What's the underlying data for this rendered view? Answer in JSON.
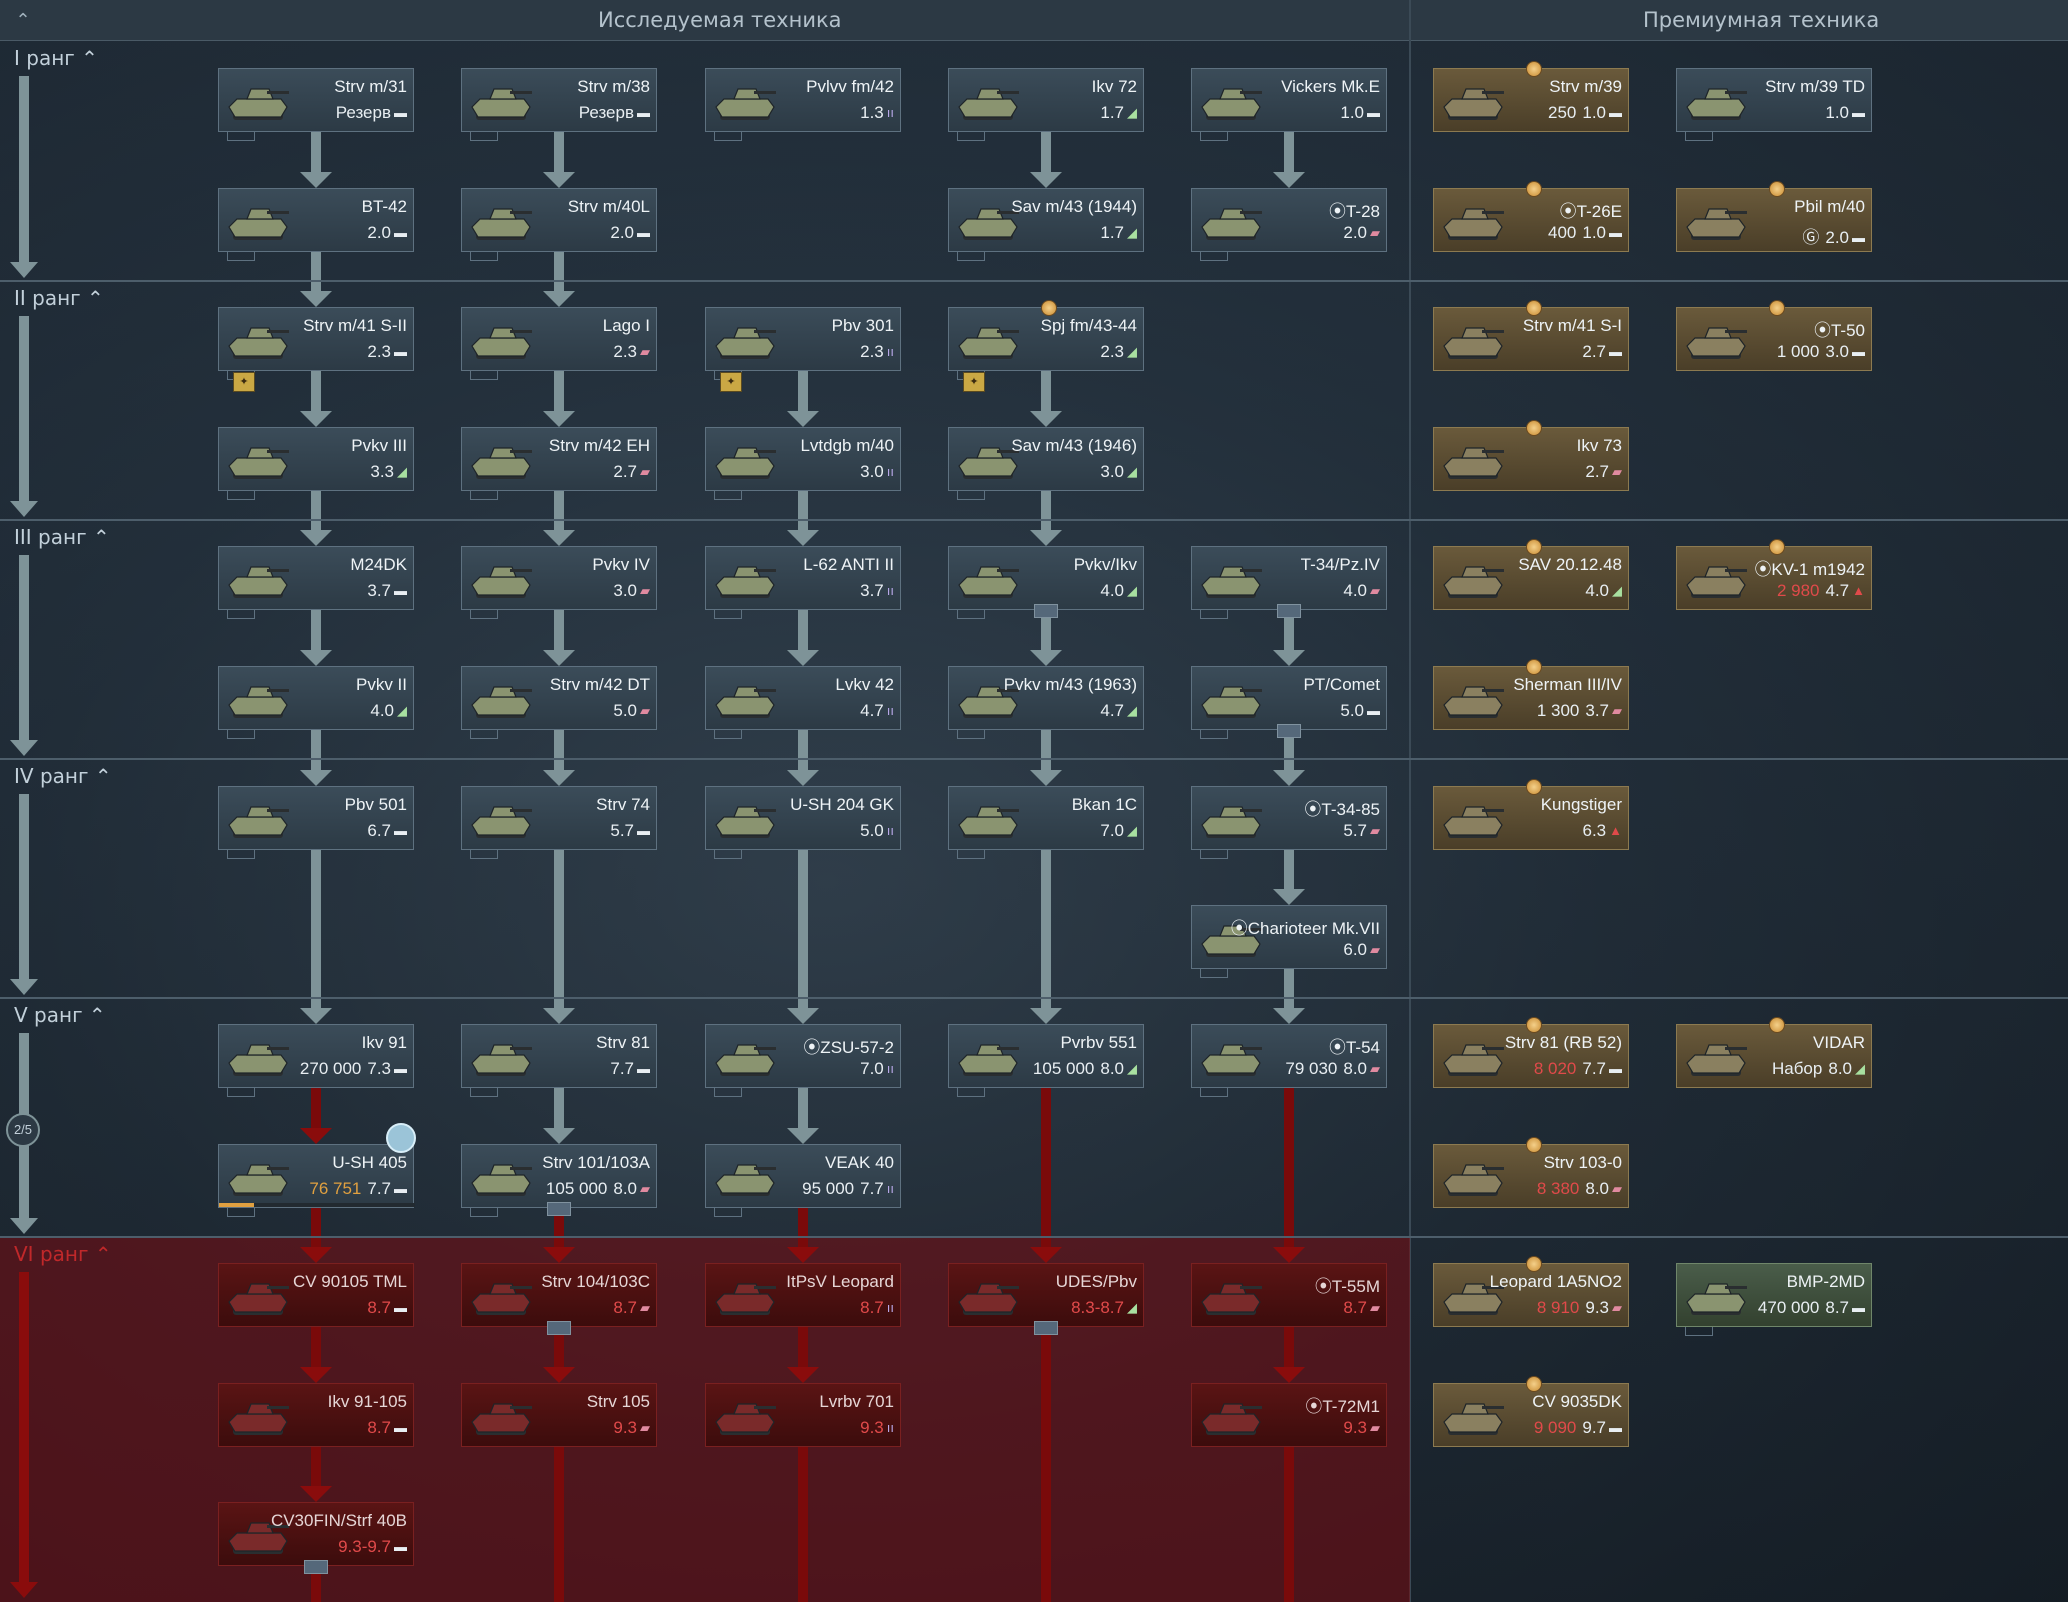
{
  "header": {
    "researched_title": "Исследуемая техника",
    "premium_title": "Премиумная техника"
  },
  "ranks": [
    "I ранг",
    "II ранг",
    "III ранг",
    "IV ранг",
    "V ранг",
    "VI ранг"
  ],
  "pager": "2/5",
  "vehicles": {
    "r1_1": {
      "name": "Strv m/31",
      "cost": "",
      "br": "Резерв",
      "role": "light"
    },
    "r1_2": {
      "name": "Strv m/38",
      "cost": "",
      "br": "Резерв",
      "role": "light"
    },
    "r1_3": {
      "name": "Pvlvv fm/42",
      "cost": "",
      "br": "1.3",
      "role": "spaa"
    },
    "r1_4": {
      "name": "Ikv 72",
      "cost": "",
      "br": "1.7",
      "role": "td"
    },
    "r1_5": {
      "name": "Vickers Mk.E",
      "cost": "",
      "br": "1.0",
      "role": "light"
    },
    "r1_6": {
      "name": "BT-42",
      "cost": "",
      "br": "2.0",
      "role": "light"
    },
    "r1_7": {
      "name": "Strv m/40L",
      "cost": "",
      "br": "2.0",
      "role": "light"
    },
    "r1_8": {
      "name": "Sav m/43 (1944)",
      "cost": "",
      "br": "1.7",
      "role": "td"
    },
    "r1_9": {
      "name": "⦿T-28",
      "cost": "",
      "br": "2.0",
      "role": "medium"
    },
    "p1_1": {
      "name": "Strv m/39",
      "cost": "250",
      "br": "1.0",
      "role": "light"
    },
    "p1_2": {
      "name": "Strv m/39 TD",
      "cost": "",
      "br": "1.0",
      "role": "light"
    },
    "p1_3": {
      "name": "⦿T-26E",
      "cost": "400",
      "br": "1.0",
      "role": "light"
    },
    "p1_4": {
      "name": "Pbil m/40",
      "cost": "Ⓖ",
      "br": "2.0",
      "role": "light"
    },
    "r2_1": {
      "name": "Strv m/41 S-II",
      "cost": "",
      "br": "2.3",
      "role": "light"
    },
    "r2_2": {
      "name": "Lago I",
      "cost": "",
      "br": "2.3",
      "role": "medium"
    },
    "r2_3": {
      "name": "Pbv 301",
      "cost": "",
      "br": "2.3",
      "role": "spaa"
    },
    "r2_4": {
      "name": "Spj fm/43-44",
      "cost": "",
      "br": "2.3",
      "role": "td"
    },
    "r2_5": {
      "name": "Pvkv III",
      "cost": "",
      "br": "3.3",
      "role": "td"
    },
    "r2_6": {
      "name": "Strv m/42 EH",
      "cost": "",
      "br": "2.7",
      "role": "medium"
    },
    "r2_7": {
      "name": "Lvtdgb m/40",
      "cost": "",
      "br": "3.0",
      "role": "spaa"
    },
    "r2_8": {
      "name": "Sav m/43 (1946)",
      "cost": "",
      "br": "3.0",
      "role": "td"
    },
    "p2_1": {
      "name": "Strv m/41 S-I",
      "cost": "",
      "br": "2.7",
      "role": "light"
    },
    "p2_2": {
      "name": "⦿T-50",
      "cost": "1 000",
      "br": "3.0",
      "role": "light"
    },
    "p2_3": {
      "name": "Ikv 73",
      "cost": "",
      "br": "2.7",
      "role": "medium"
    },
    "r3_1": {
      "name": "M24DK",
      "cost": "",
      "br": "3.7",
      "role": "light"
    },
    "r3_2": {
      "name": "Pvkv IV",
      "cost": "",
      "br": "3.0",
      "role": "medium"
    },
    "r3_3": {
      "name": "L-62 ANTI II",
      "cost": "",
      "br": "3.7",
      "role": "spaa"
    },
    "r3_4": {
      "name": "Pvkv/Ikv",
      "cost": "",
      "br": "4.0",
      "role": "td"
    },
    "r3_5": {
      "name": "T-34/Pz.IV",
      "cost": "",
      "br": "4.0",
      "role": "medium"
    },
    "r3_6": {
      "name": "Pvkv II",
      "cost": "",
      "br": "4.0",
      "role": "td"
    },
    "r3_7": {
      "name": "Strv m/42 DT",
      "cost": "",
      "br": "5.0",
      "role": "medium"
    },
    "r3_8": {
      "name": "Lvkv 42",
      "cost": "",
      "br": "4.7",
      "role": "spaa"
    },
    "r3_9": {
      "name": "Pvkv m/43 (1963)",
      "cost": "",
      "br": "4.7",
      "role": "td"
    },
    "r3_10": {
      "name": "PT/Comet",
      "cost": "",
      "br": "5.0",
      "role": "light"
    },
    "p3_1": {
      "name": "SAV 20.12.48",
      "cost": "",
      "br": "4.0",
      "role": "td"
    },
    "p3_2": {
      "name": "⦿KV-1 m1942",
      "cost": "2 980",
      "br": "4.7",
      "role": "heavy"
    },
    "p3_3": {
      "name": "Sherman III/IV",
      "cost": "1 300",
      "br": "3.7",
      "role": "medium"
    },
    "r4_1": {
      "name": "Pbv 501",
      "cost": "",
      "br": "6.7",
      "role": "light"
    },
    "r4_2": {
      "name": "Strv 74",
      "cost": "",
      "br": "5.7",
      "role": "light"
    },
    "r4_3": {
      "name": "U-SH 204 GK",
      "cost": "",
      "br": "5.0",
      "role": "spaa"
    },
    "r4_4": {
      "name": "Bkan 1C",
      "cost": "",
      "br": "7.0",
      "role": "td"
    },
    "r4_5": {
      "name": "⦿T-34-85",
      "cost": "",
      "br": "5.7",
      "role": "medium"
    },
    "r4_6": {
      "name": "⦿Charioteer Mk.VII",
      "cost": "",
      "br": "6.0",
      "role": "medium"
    },
    "p4_1": {
      "name": "Kungstiger",
      "cost": "",
      "br": "6.3",
      "role": "heavy"
    },
    "r5_1": {
      "name": "Ikv 91",
      "cost": "270 000",
      "br": "7.3",
      "role": "light"
    },
    "r5_2": {
      "name": "Strv 81",
      "cost": "",
      "br": "7.7",
      "role": "light"
    },
    "r5_3": {
      "name": "⦿ZSU-57-2",
      "cost": "",
      "br": "7.0",
      "role": "spaa"
    },
    "r5_4": {
      "name": "Pvrbv 551",
      "cost": "105 000",
      "br": "8.0",
      "role": "td"
    },
    "r5_5": {
      "name": "⦿T-54",
      "cost": "79 030",
      "br": "8.0",
      "role": "medium"
    },
    "r5_6": {
      "name": "U-SH 405",
      "cost": "76 751",
      "br": "7.7",
      "role": "light"
    },
    "r5_7": {
      "name": "Strv 101/103A",
      "cost": "105 000",
      "br": "8.0",
      "role": "medium"
    },
    "r5_8": {
      "name": "VEAK 40",
      "cost": "95 000",
      "br": "7.7",
      "role": "spaa"
    },
    "p5_1": {
      "name": "Strv 81 (RB 52)",
      "cost": "8 020",
      "br": "7.7",
      "role": "light"
    },
    "p5_2": {
      "name": "VIDAR",
      "cost": "Набор",
      "br": "8.0",
      "role": "td"
    },
    "p5_3": {
      "name": "Strv 103-0",
      "cost": "8 380",
      "br": "8.0",
      "role": "medium"
    },
    "r6_1": {
      "name": "CV 90105 TML",
      "cost": "",
      "br": "8.7",
      "role": "light"
    },
    "r6_2": {
      "name": "Strv 104/103C",
      "cost": "",
      "br": "8.7",
      "role": "medium"
    },
    "r6_3": {
      "name": "ItPsV Leopard",
      "cost": "",
      "br": "8.7",
      "role": "spaa"
    },
    "r6_4": {
      "name": "UDES/Pbv",
      "cost": "",
      "br": "8.3-8.7",
      "role": "td"
    },
    "r6_5": {
      "name": "⦿T-55M",
      "cost": "",
      "br": "8.7",
      "role": "medium"
    },
    "r6_6": {
      "name": "Ikv 91-105",
      "cost": "",
      "br": "8.7",
      "role": "light"
    },
    "r6_7": {
      "name": "Strv 105",
      "cost": "",
      "br": "9.3",
      "role": "medium"
    },
    "r6_8": {
      "name": "Lvrbv 701",
      "cost": "",
      "br": "9.3",
      "role": "spaa"
    },
    "r6_9": {
      "name": "⦿T-72M1",
      "cost": "",
      "br": "9.3",
      "role": "medium"
    },
    "r6_10": {
      "name": "CV30FIN/Strf 40B",
      "cost": "",
      "br": "9.3-9.7",
      "role": "light"
    },
    "p6_1": {
      "name": "Leopard 1A5NO2",
      "cost": "8 910",
      "br": "9.3",
      "role": "medium"
    },
    "p6_2": {
      "name": "BMP-2MD",
      "cost": "470 000",
      "br": "8.7",
      "role": "light"
    },
    "p6_3": {
      "name": "CV 9035DK",
      "cost": "9 090",
      "br": "9.7",
      "role": "light"
    }
  },
  "colors": {
    "accent": "#7e9398",
    "premium": "#6a5a3b",
    "locked": "#5a1414",
    "highlight": "#e04a4a"
  }
}
